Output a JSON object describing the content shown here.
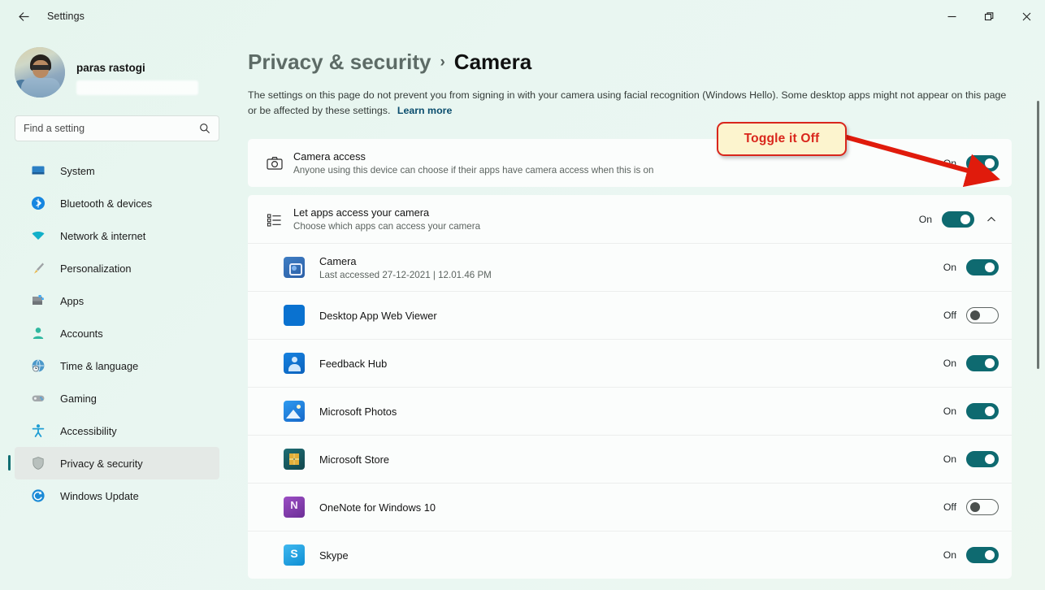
{
  "window": {
    "title": "Settings",
    "back_icon": "back-arrow-icon",
    "controls": {
      "minimize": "—",
      "restore": "❐",
      "close": "✕"
    }
  },
  "sidebar": {
    "profile": {
      "name": "paras rastogi",
      "email_hidden": true
    },
    "search": {
      "placeholder": "Find a setting",
      "value": "",
      "icon": "search-icon"
    },
    "items": [
      {
        "label": "System",
        "icon": "monitor-icon",
        "selected": false
      },
      {
        "label": "Bluetooth & devices",
        "icon": "bluetooth-icon",
        "selected": false
      },
      {
        "label": "Network & internet",
        "icon": "wifi-icon",
        "selected": false
      },
      {
        "label": "Personalization",
        "icon": "paintbrush-icon",
        "selected": false
      },
      {
        "label": "Apps",
        "icon": "apps-grid-icon",
        "selected": false
      },
      {
        "label": "Accounts",
        "icon": "person-icon",
        "selected": false
      },
      {
        "label": "Time & language",
        "icon": "clock-globe-icon",
        "selected": false
      },
      {
        "label": "Gaming",
        "icon": "gamepad-icon",
        "selected": false
      },
      {
        "label": "Accessibility",
        "icon": "accessibility-icon",
        "selected": false
      },
      {
        "label": "Privacy & security",
        "icon": "shield-icon",
        "selected": true
      },
      {
        "label": "Windows Update",
        "icon": "update-icon",
        "selected": false
      }
    ]
  },
  "main": {
    "breadcrumb": {
      "parent": "Privacy & security",
      "separator": "›",
      "current": "Camera"
    },
    "description": "The settings on this page do not prevent you from signing in with your camera using facial recognition (Windows Hello). Some desktop apps might not appear on this page or be affected by these settings.",
    "learn_more": "Learn more",
    "camera_access": {
      "title": "Camera access",
      "subtitle": "Anyone using this device can choose if their apps have camera access when this is on",
      "icon": "camera-icon",
      "state_label": "On",
      "state": "on"
    },
    "let_apps": {
      "title": "Let apps access your camera",
      "subtitle": "Choose which apps can access your camera",
      "icon": "list-icon",
      "state_label": "On",
      "state": "on",
      "expand_icon": "chevron-up-icon",
      "expanded": true
    },
    "apps": [
      {
        "name": "Camera",
        "subtitle": "Last accessed 27-12-2021  |  12.01.46 PM",
        "icon": "camera-app-icon",
        "state_label": "On",
        "state": "on"
      },
      {
        "name": "Desktop App Web Viewer",
        "subtitle": "",
        "icon": "desktop-web-viewer-icon",
        "state_label": "Off",
        "state": "off"
      },
      {
        "name": "Feedback Hub",
        "subtitle": "",
        "icon": "feedback-hub-icon",
        "state_label": "On",
        "state": "on"
      },
      {
        "name": "Microsoft Photos",
        "subtitle": "",
        "icon": "microsoft-photos-icon",
        "state_label": "On",
        "state": "on"
      },
      {
        "name": "Microsoft Store",
        "subtitle": "",
        "icon": "microsoft-store-icon",
        "state_label": "On",
        "state": "on"
      },
      {
        "name": "OneNote for Windows 10",
        "subtitle": "",
        "icon": "onenote-icon",
        "state_label": "Off",
        "state": "off"
      },
      {
        "name": "Skype",
        "subtitle": "",
        "icon": "skype-icon",
        "state_label": "On",
        "state": "on"
      }
    ]
  },
  "annotation": {
    "callout_text": "Toggle it Off",
    "callout_bg": "#fcf4ce",
    "callout_border": "#d9261c",
    "callout_text_color": "#d9261c",
    "arrow_color": "#e01b0c"
  },
  "colors": {
    "accent_toggle_on": "#0e6a70",
    "page_bg": "#e9f6f1",
    "card_bg": "#fbfdfc",
    "link": "#0a4d6e"
  }
}
